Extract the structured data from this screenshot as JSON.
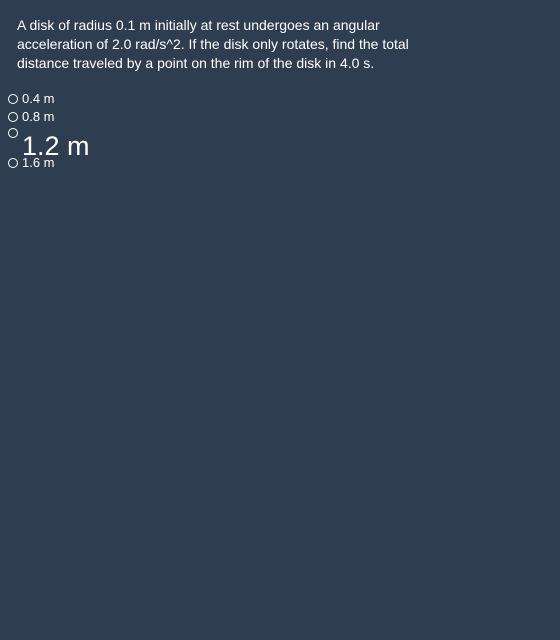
{
  "question": {
    "line1": "A disk of radius 0.1 m initially at rest undergoes an angular",
    "line2": "acceleration of 2.0 rad/s^2. If the disk only rotates, find the total",
    "line3": "distance traveled by a point on the rim of the disk in 4.0 s."
  },
  "options": [
    {
      "label": "0.4 m"
    },
    {
      "label": "0.8 m"
    },
    {
      "label": "1.2 m"
    },
    {
      "label": "1.6 m"
    }
  ],
  "colors": {
    "background": "#2e3d4f",
    "text": "#ffffff"
  }
}
